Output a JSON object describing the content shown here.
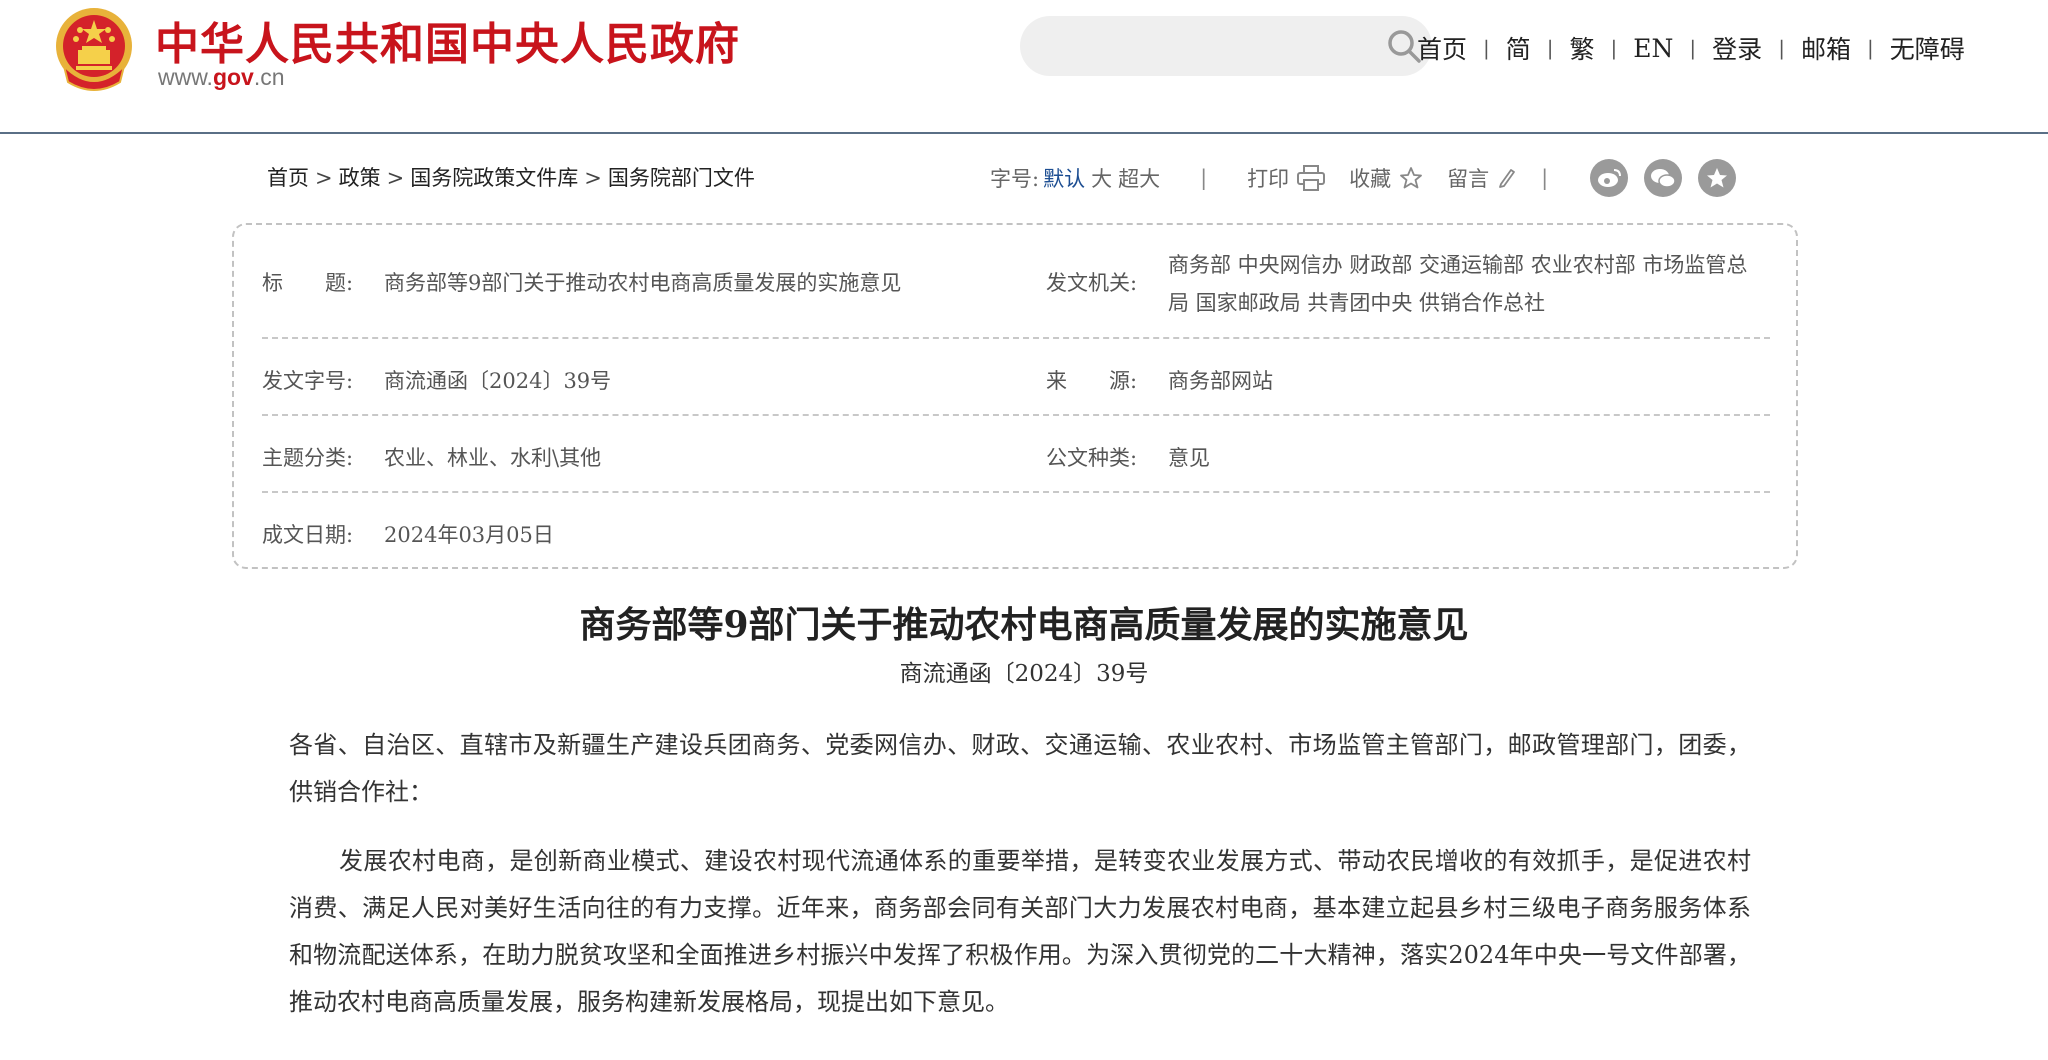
{
  "header": {
    "site_title": "中华人民共和国中央人民政府",
    "site_url_prefix": "www.",
    "site_url_gov": "gov",
    "site_url_suffix": ".cn",
    "search": {
      "placeholder": "",
      "value": ""
    },
    "nav": [
      "首页",
      "简",
      "繁",
      "EN",
      "登录",
      "邮箱",
      "无障碍"
    ],
    "colors": {
      "brand_red": "#c8141c",
      "header_rule": "#5a6f86"
    }
  },
  "breadcrumb": [
    "首页",
    "政策",
    "国务院政策文件库",
    "国务院部门文件"
  ],
  "toolbar": {
    "font_size_label": "字号:",
    "font_size_options": [
      "默认",
      "大",
      "超大"
    ],
    "font_size_selected": "默认",
    "separator": "|",
    "print": "打印",
    "favorite": "收藏",
    "comment": "留言",
    "share_icons": [
      "weibo-icon",
      "wechat-icon",
      "star-badge-icon"
    ]
  },
  "info": {
    "title_label": "标　　题:",
    "title_value": "商务部等9部门关于推动农村电商高质量发展的实施意见",
    "issuer_label": "发文机关:",
    "issuer_line1": "商务部 中央网信办 财政部 交通运输部 农业农村部 市场监管总",
    "issuer_line2": "局 国家邮政局 共青团中央 供销合作总社",
    "docno_label": "发文字号:",
    "docno_value": "商流通函〔2024〕39号",
    "source_label": "来　　源:",
    "source_value": "商务部网站",
    "topic_label": "主题分类:",
    "topic_value": "农业、林业、水利\\其他",
    "doctype_label": "公文种类:",
    "doctype_value": "意见",
    "date_label": "成文日期:",
    "date_value": "2024年03月05日"
  },
  "article": {
    "title": "商务部等9部门关于推动农村电商高质量发展的实施意见",
    "doc_no": "商流通函〔2024〕39号",
    "salutation": "各省、自治区、直辖市及新疆生产建设兵团商务、党委网信办、财政、交通运输、农业农村、市场监管主管部门，邮政管理部门，团委，供销合作社：",
    "paragraph1": "发展农村电商，是创新商业模式、建设农村现代流通体系的重要举措，是转变农业发展方式、带动农民增收的有效抓手，是促进农村消费、满足人民对美好生活向往的有力支撑。近年来，商务部会同有关部门大力发展农村电商，基本建立起县乡村三级电子商务服务体系和物流配送体系，在助力脱贫攻坚和全面推进乡村振兴中发挥了积极作用。为深入贯彻党的二十大精神，落实2024年中央一号文件部署，推动农村电商高质量发展，服务构建新发展格局，现提出如下意见。"
  }
}
